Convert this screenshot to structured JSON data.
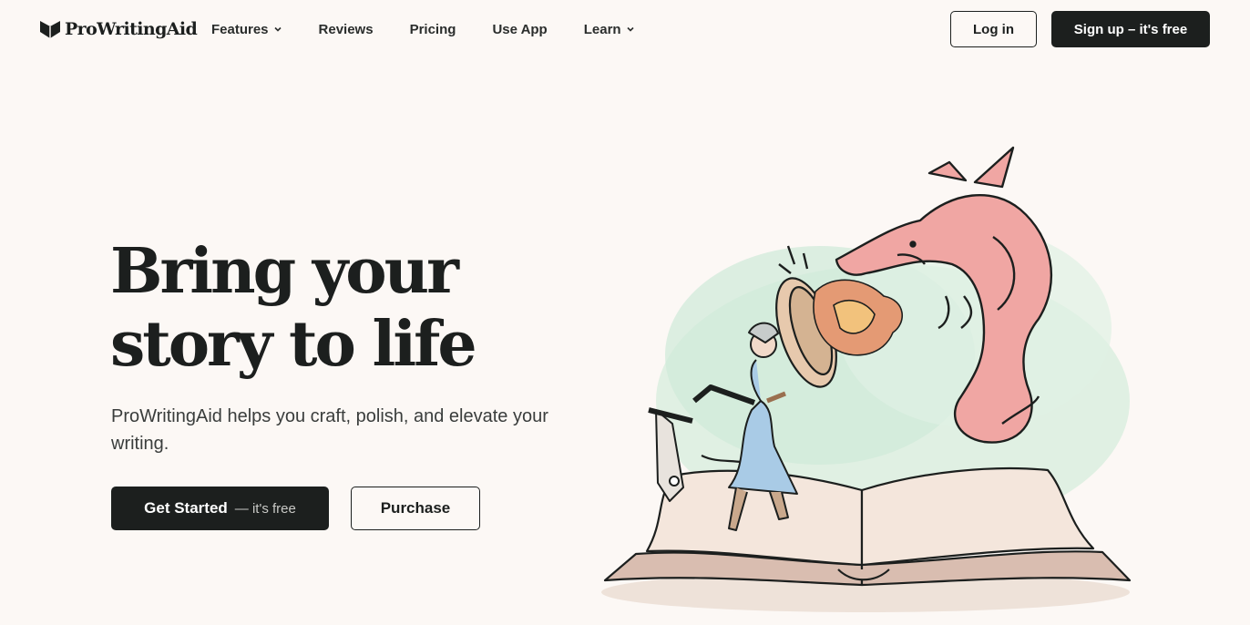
{
  "header": {
    "logo_text": "ProWritingAid",
    "nav": [
      {
        "label": "Features",
        "has_dropdown": true
      },
      {
        "label": "Reviews",
        "has_dropdown": false
      },
      {
        "label": "Pricing",
        "has_dropdown": false
      },
      {
        "label": "Use App",
        "has_dropdown": false
      },
      {
        "label": "Learn",
        "has_dropdown": true
      }
    ],
    "login_label": "Log in",
    "signup_label": "Sign up – it's free"
  },
  "hero": {
    "title_line1": "Bring your",
    "title_line2": "story to life",
    "subtitle": "ProWritingAid helps you craft, polish, and elevate your writing.",
    "start_label": "Get Started",
    "start_sub": "— it's free",
    "purchase_label": "Purchase"
  },
  "colors": {
    "background": "#fcf8f5",
    "primary_dark": "#1c1f1e",
    "dragon_pink": "#f0a6a3",
    "knight_blue": "#a9cbe6",
    "splash_green": "#cfe9d8"
  },
  "icons": {
    "logo": "prowritingaid-logo-icon",
    "dropdown": "chevron-down-icon"
  }
}
